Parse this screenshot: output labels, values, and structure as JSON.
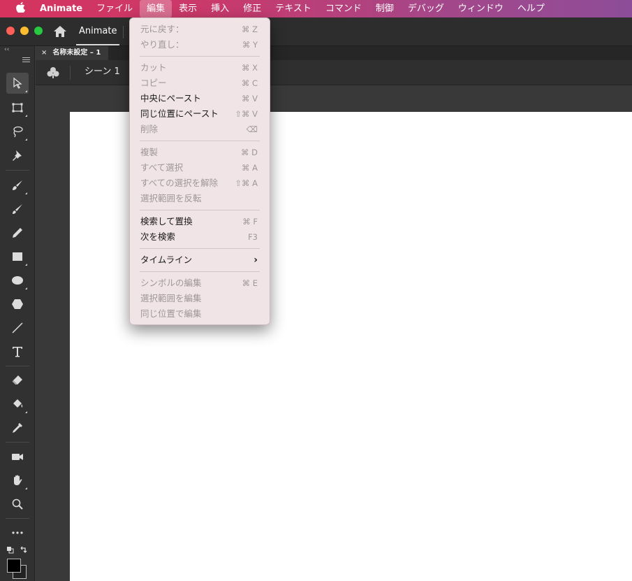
{
  "menubar": {
    "apple": "",
    "items": [
      "Animate",
      "ファイル",
      "編集",
      "表示",
      "挿入",
      "修正",
      "テキスト",
      "コマンド",
      "制御",
      "デバッグ",
      "ウィンドウ",
      "ヘルプ"
    ]
  },
  "titlebar": {
    "app_tab": "Animate"
  },
  "document": {
    "tab_title": "名称未設定 – 1",
    "tab_close": "×"
  },
  "scene": {
    "label": "シーン 1"
  },
  "toolbar": {
    "collapse": "‹‹"
  },
  "edit_menu": {
    "groups": [
      [
        {
          "label": "元に戻す：",
          "shortcut": "⌘ Z",
          "enabled": false
        },
        {
          "label": "やり直し：",
          "shortcut": "⌘ Y",
          "enabled": false
        }
      ],
      [
        {
          "label": "カット",
          "shortcut": "⌘ X",
          "enabled": false
        },
        {
          "label": "コピー",
          "shortcut": "⌘ C",
          "enabled": false
        },
        {
          "label": "中央にペースト",
          "shortcut": "⌘ V",
          "enabled": true
        },
        {
          "label": "同じ位置にペースト",
          "shortcut": "⇧⌘ V",
          "enabled": true
        },
        {
          "label": "削除",
          "shortcut": "⌫",
          "enabled": false
        }
      ],
      [
        {
          "label": "複製",
          "shortcut": "⌘ D",
          "enabled": false
        },
        {
          "label": "すべて選択",
          "shortcut": "⌘ A",
          "enabled": false
        },
        {
          "label": "すべての選択を解除",
          "shortcut": "⇧⌘ A",
          "enabled": false
        },
        {
          "label": "選択範囲を反転",
          "shortcut": "",
          "enabled": false
        }
      ],
      [
        {
          "label": "検索して置換",
          "shortcut": "⌘ F",
          "enabled": true
        },
        {
          "label": "次を検索",
          "shortcut": "F3",
          "enabled": true
        }
      ],
      [
        {
          "label": "タイムライン",
          "shortcut": "›",
          "enabled": true
        }
      ],
      [
        {
          "label": "シンボルの編集",
          "shortcut": "⌘ E",
          "enabled": false
        },
        {
          "label": "選択範囲を編集",
          "shortcut": "",
          "enabled": false
        },
        {
          "label": "同じ位置で編集",
          "shortcut": "",
          "enabled": false
        }
      ]
    ]
  },
  "colors": {
    "menubar_start": "#d6335e",
    "menubar_end": "#8d4d98",
    "stage": "#ffffff",
    "menu_bg": "#f0e4e6"
  }
}
